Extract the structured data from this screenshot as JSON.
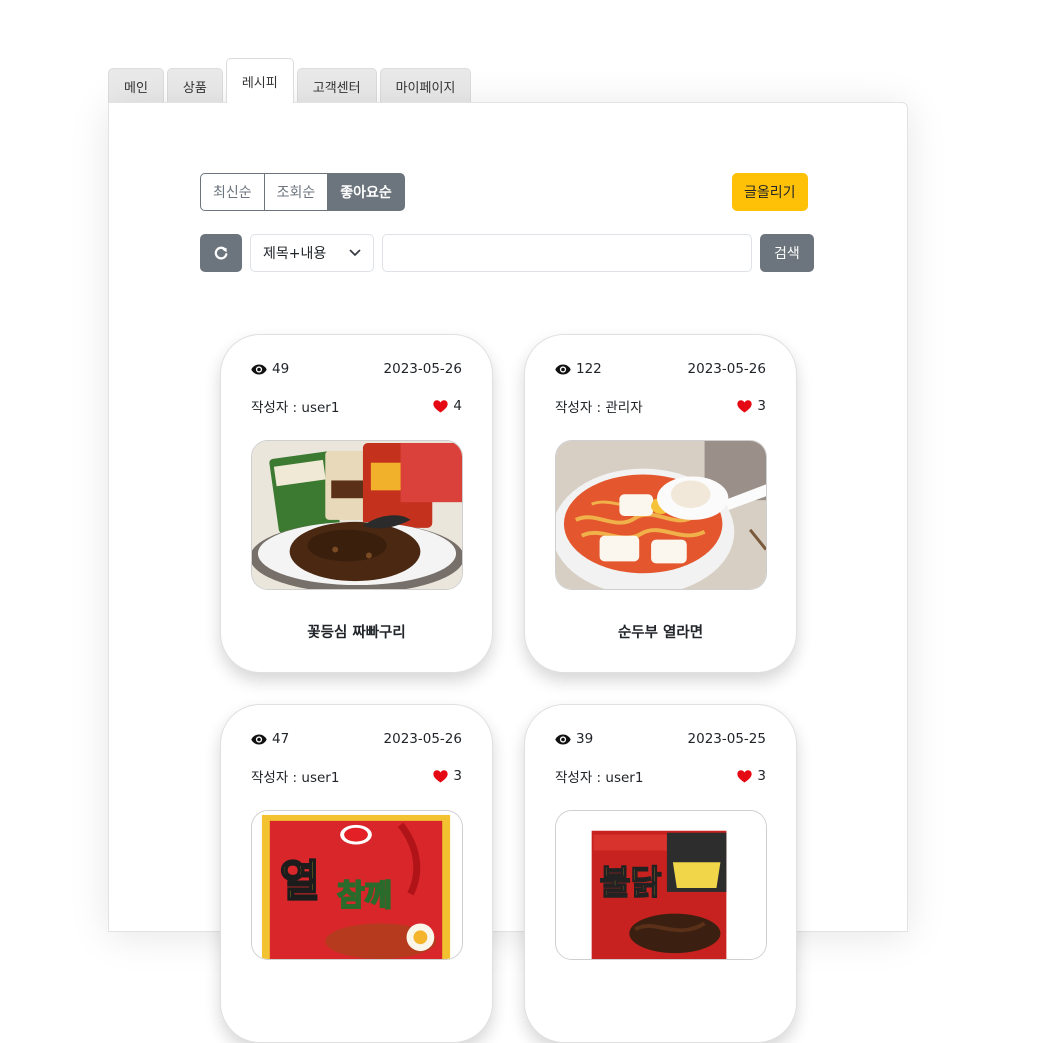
{
  "tabs": [
    {
      "label": "메인",
      "active": false
    },
    {
      "label": "상품",
      "active": false
    },
    {
      "label": "레시피",
      "active": true
    },
    {
      "label": "고객센터",
      "active": false
    },
    {
      "label": "마이페이지",
      "active": false
    }
  ],
  "sort": {
    "latest": "최신순",
    "views": "조회순",
    "likes": "좋아요순",
    "selected": "좋아요순"
  },
  "write_button": "글올리기",
  "search": {
    "refresh_icon": "refresh-icon",
    "select_value": "제목+내용",
    "input_value": "",
    "button": "검색"
  },
  "colors": {
    "secondary": "#6c757d",
    "warning": "#ffc107",
    "heart": "#e50914"
  },
  "posts": [
    {
      "views": "49",
      "date": "2023-05-26",
      "author_label": "작성자 : user1",
      "likes": "4",
      "title": "꽃등심 짜빠구리",
      "image_icon": "jjapaguri-photo"
    },
    {
      "views": "122",
      "date": "2023-05-26",
      "author_label": "작성자 : 관리자",
      "likes": "3",
      "title": "순두부 열라면",
      "image_icon": "sundubu-ramen-photo"
    },
    {
      "views": "47",
      "date": "2023-05-26",
      "author_label": "작성자 : user1",
      "likes": "3",
      "title": "",
      "image_icon": "yeol-ramen-package-photo",
      "package_text": "참깨"
    },
    {
      "views": "39",
      "date": "2023-05-25",
      "author_label": "작성자 : user1",
      "likes": "3",
      "title": "",
      "image_icon": "buldak-package-photo",
      "package_text": "불닭"
    }
  ]
}
